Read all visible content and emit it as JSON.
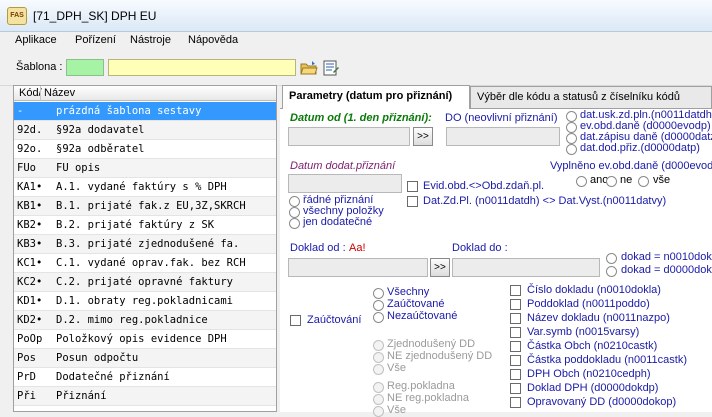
{
  "window": {
    "title": "[71_DPH_SK] DPH EU",
    "logo": "FAS"
  },
  "menu": [
    "Aplikace",
    "Pořízení",
    "Nástroje",
    "Nápověda"
  ],
  "toolbar": {
    "sablona_label": "Šablona :",
    "code_value": "",
    "name_value": "",
    "open_icon": "folder-open-icon",
    "list_icon": "list-edit-icon"
  },
  "list": {
    "col_kod": "Kód/",
    "col_nazev": "Název",
    "rows": [
      {
        "kod": "-",
        "nazev": "prázdná šablona sestavy"
      },
      {
        "kod": "92d.",
        "nazev": "§92a dodavatel"
      },
      {
        "kod": "92o.",
        "nazev": "§92a odběratel"
      },
      {
        "kod": "FUo",
        "nazev": "FU opis"
      },
      {
        "kod": "KA1•",
        "nazev": "A.1. vydané faktúry s % DPH"
      },
      {
        "kod": "KB1•",
        "nazev": "B.1. prijaté fak.z EU,3Z,SKRCH"
      },
      {
        "kod": "KB2•",
        "nazev": "B.2. prijaté faktúry z SK"
      },
      {
        "kod": "KB3•",
        "nazev": "B.3. prijaté zjednodušené fa."
      },
      {
        "kod": "KC1•",
        "nazev": "C.1. vydané oprav.fak. bez RCH"
      },
      {
        "kod": "KC2•",
        "nazev": "C.2. prijaté opravné faktury"
      },
      {
        "kod": "KD1•",
        "nazev": "D.1. obraty reg.pokladnicami"
      },
      {
        "kod": "KD2•",
        "nazev": "D.2. mimo reg.pokladnice"
      },
      {
        "kod": "PoOp",
        "nazev": "Položkový opis evidence DPH"
      },
      {
        "kod": "Pos",
        "nazev": "Posun odpočtu"
      },
      {
        "kod": "PrD",
        "nazev": "Dodatečné přiznání"
      },
      {
        "kod": "Při",
        "nazev": "Přiznání"
      }
    ]
  },
  "tabs": [
    "Parametry (datum pro přiznání)",
    "Výběr dle kódu a statusů z číselníku kódů"
  ],
  "params": {
    "datum_od": "Datum od (1. den přiznání):",
    "do_label": "DO (neovlivní přiznání)",
    "arrow_btn": ">>",
    "date_radios": [
      "dat.usk.zd.pln.(n0011datdh)",
      "ev.obd.daně (d0000evodp)",
      "dat.zápisu daně (d0000datz",
      "dat.dod.přiz.(d0000datp)"
    ],
    "datum_dodat": "Datum dodat.přiznání",
    "priznani_radios": [
      "řádné přiznání",
      "všechny položky",
      "jen dodatečné"
    ],
    "chk_evid": "Evid.obd.<>Obd.zdaň.pl.",
    "chk_datzd": "Dat.Zd.Pl. (n0011datdh) <> Dat.Vyst.(n0011datvy)",
    "vyplneno": "Vyplněno ev.obd.daně (d000evodp",
    "vyplneno_opts": [
      "ano",
      "ne",
      "vše"
    ],
    "doklad_od": "Doklad od :",
    "doklad_od_hint": "Aa!",
    "doklad_do": "Doklad do :",
    "doklad_radios": [
      "dokad = n0010dokla",
      "dokad = d0000dokl"
    ],
    "zauct_radios": [
      "Všechny",
      "Zaúčtované",
      "Nezaúčtované"
    ],
    "zauct_chk": "Zaúčtování",
    "zjedn_radios": [
      "Zjednodušený DD",
      "NE zjednodušený DD",
      "Vše"
    ],
    "regp_radios": [
      "Reg.pokladna",
      "NE reg.pokladna",
      "Vše"
    ],
    "field_chks": [
      "Číslo dokladu (n0010dokla)",
      "Poddoklad (n0011poddo)",
      "Název dokladu (n0011nazpo)",
      "Var.symb (n0015varsy)",
      "Částka Obch (n0210castk)",
      "Částka poddokladu (n0011castk)",
      "DPH Obch (n0210cedph)",
      "Doklad DPH (d0000dokdp)",
      "Opravovaný DD (d0000dokop)"
    ]
  }
}
